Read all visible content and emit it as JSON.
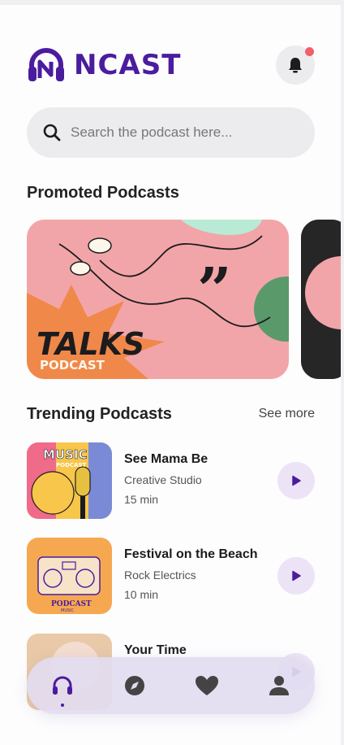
{
  "app": {
    "logo_text": "NCAST"
  },
  "search": {
    "placeholder": "Search the podcast here..."
  },
  "promoted": {
    "title": "Promoted Podcasts",
    "cards": [
      {
        "title": "TALKS",
        "subtitle": "PODCAST"
      }
    ]
  },
  "trending": {
    "title": "Trending Podcasts",
    "see_more": "See more",
    "items": [
      {
        "title": "See Mama Be",
        "author": "Creative Studio",
        "duration": "15 min",
        "thumb_text": "MUSIC",
        "thumb_sub": "PODCAST"
      },
      {
        "title": "Festival on the Beach",
        "author": "Rock Electrics",
        "duration": "10 min",
        "thumb_text": "PODCAST",
        "thumb_sub": "MUSIC"
      },
      {
        "title": "Your Time",
        "author": "",
        "duration": ""
      }
    ]
  },
  "nav": {
    "items": [
      {
        "icon": "headphones-icon",
        "active": true
      },
      {
        "icon": "compass-icon",
        "active": false
      },
      {
        "icon": "heart-icon",
        "active": false
      },
      {
        "icon": "profile-icon",
        "active": false
      }
    ]
  },
  "colors": {
    "brand": "#4b1c9e",
    "notification": "#f0606b",
    "play_bg": "#ece4f6"
  }
}
